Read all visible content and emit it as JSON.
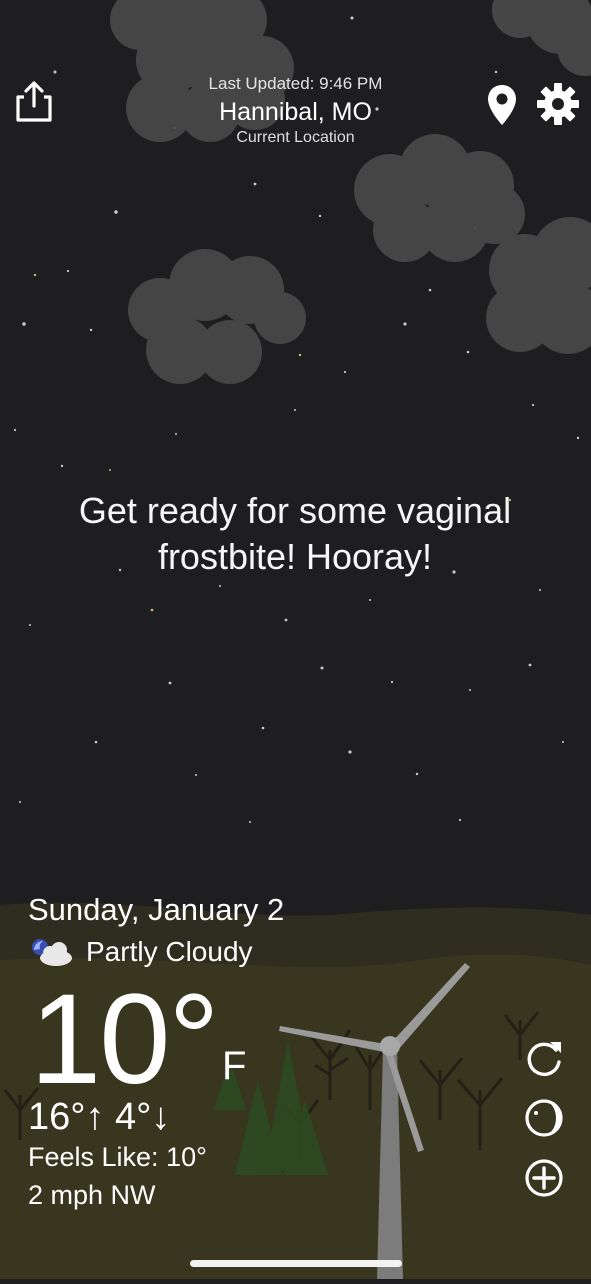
{
  "header": {
    "last_updated": "Last Updated: 9:46 PM",
    "city": "Hannibal, MO",
    "location_label": "Current Location"
  },
  "message": "Get ready for some vaginal frostbite! Hooray!",
  "forecast": {
    "date": "Sunday, January 2",
    "condition": "Partly Cloudy",
    "temperature": "10°",
    "unit": "F",
    "high_low": "16°↑ 4°↓",
    "feels_like": "Feels Like: 10°",
    "wind": "2 mph NW"
  },
  "icons": {
    "share": "share-icon",
    "location": "location-pin-icon",
    "settings": "gear-icon",
    "condition": "partly-cloudy-night-icon",
    "refresh": "refresh-icon",
    "moon": "moon-phase-icon",
    "add": "add-icon"
  },
  "colors": {
    "sky": "#1e1e20",
    "cloud": "#4a4a4a",
    "ground": "#34321f",
    "text": "#ffffff"
  }
}
